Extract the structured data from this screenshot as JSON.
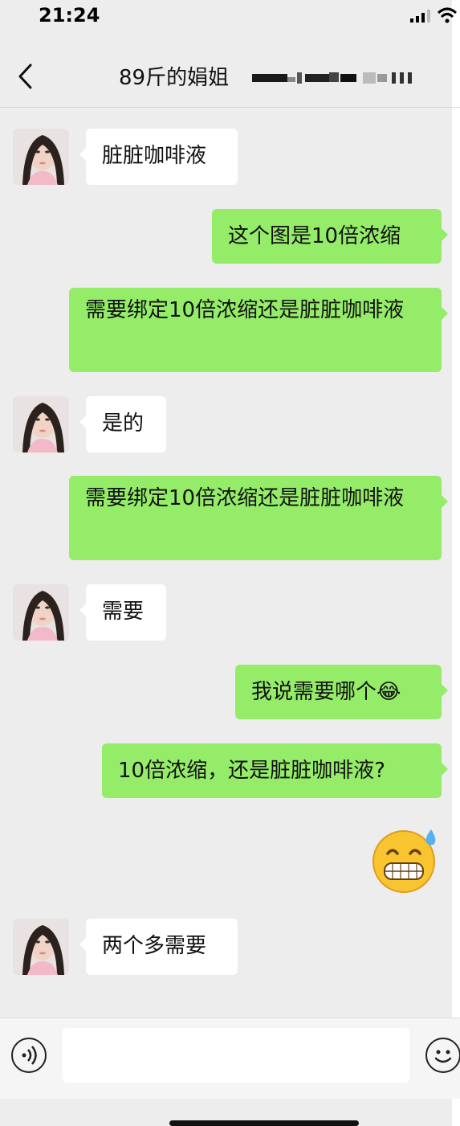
{
  "status_bar": {
    "time": "21:24"
  },
  "header": {
    "title": "89斤的娟姐"
  },
  "messages": [
    {
      "side": "in",
      "text": "脏脏咖啡液"
    },
    {
      "side": "out",
      "text": "这个图是10倍浓缩"
    },
    {
      "side": "out",
      "text": "需要绑定10倍浓缩还是脏脏咖啡液"
    },
    {
      "side": "in",
      "text": "是的"
    },
    {
      "side": "out",
      "text": "需要绑定10倍浓缩还是脏脏咖啡液"
    },
    {
      "side": "in",
      "text": "需要"
    },
    {
      "side": "out",
      "text": "我说需要哪个",
      "emoji": "😂"
    },
    {
      "side": "out",
      "text": "10倍浓缩，还是脏脏咖啡液?"
    },
    {
      "side": "out",
      "type": "sticker",
      "icon": "grinning-sweat-sticker"
    },
    {
      "side": "in",
      "text": "两个多需要"
    }
  ],
  "input": {
    "value": "",
    "placeholder": ""
  },
  "colors": {
    "background": "#ededed",
    "incoming_bubble": "#ffffff",
    "outgoing_bubble": "#95ec69"
  }
}
